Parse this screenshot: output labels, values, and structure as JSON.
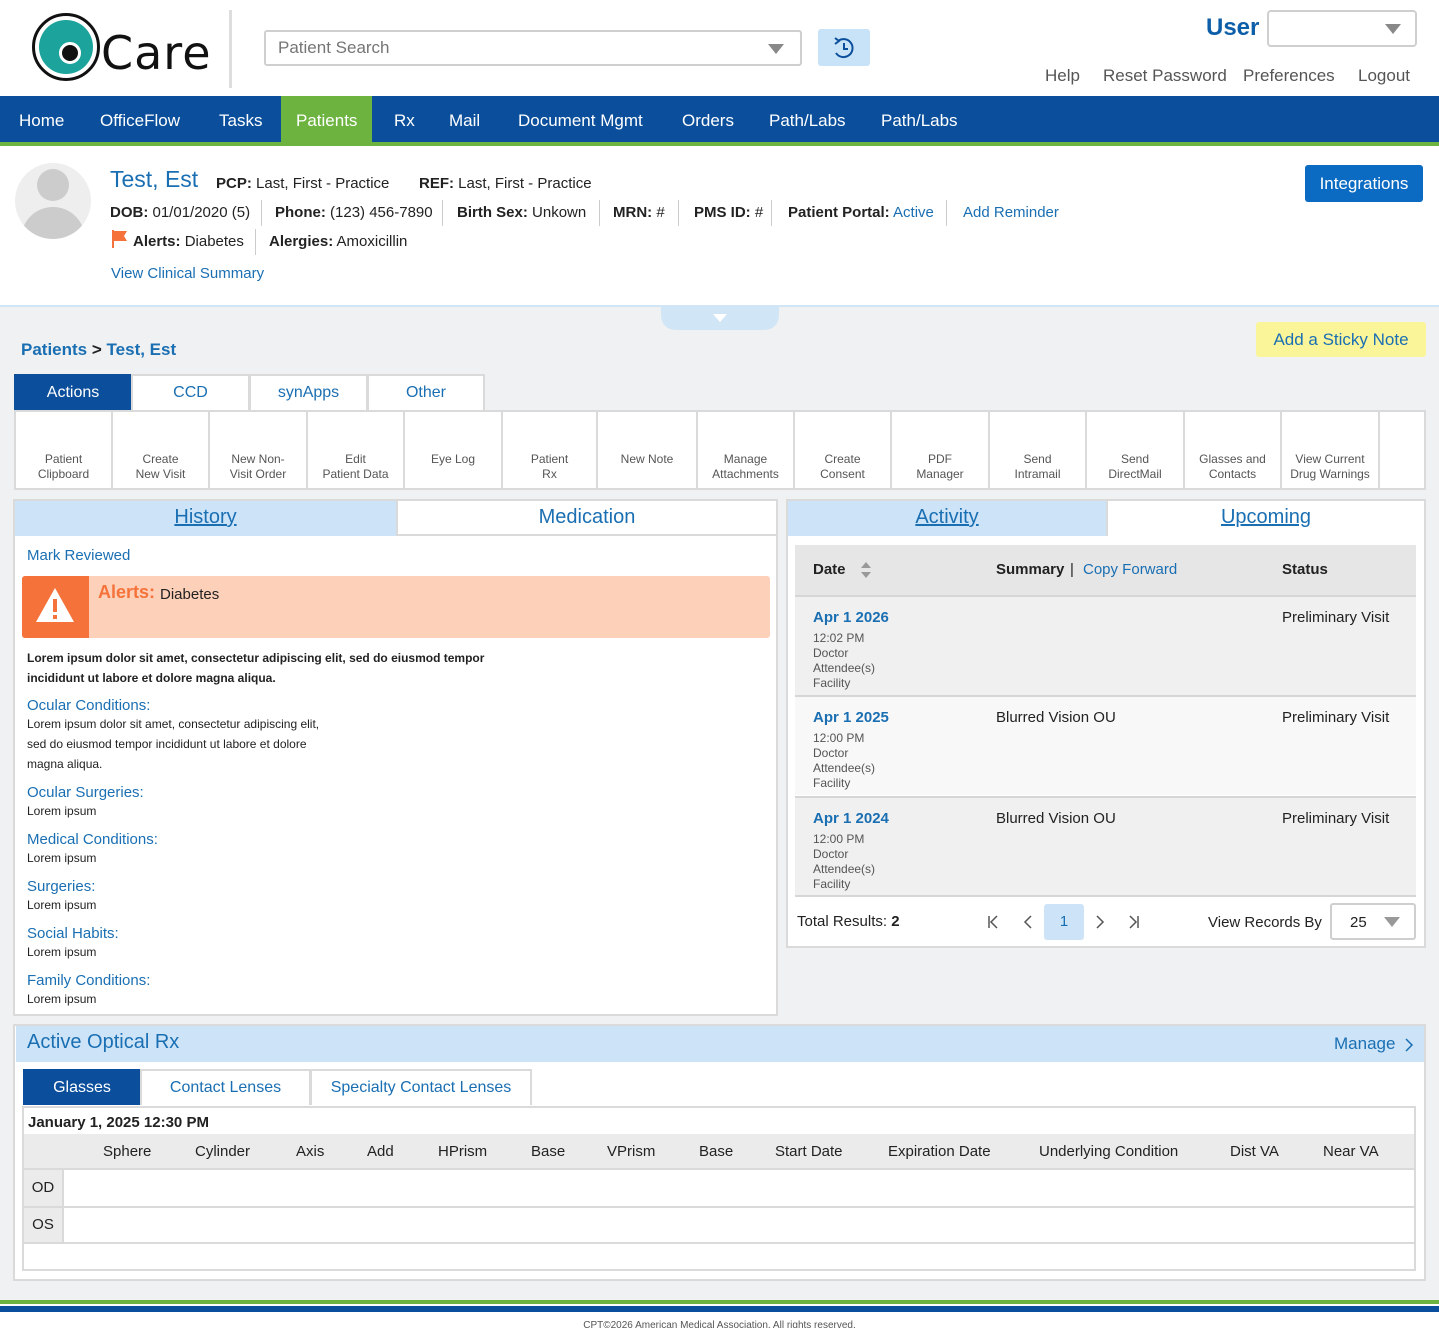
{
  "app": {
    "logo_text": "Care",
    "search_placeholder": "Patient Search",
    "user_label": "User",
    "top_links": [
      "Help",
      "Reset Password",
      "Preferences",
      "Logout"
    ]
  },
  "nav": {
    "items": [
      "Home",
      "OfficeFlow",
      "Tasks",
      "Patients",
      "Rx",
      "Mail",
      "Document Mgmt",
      "Orders",
      "Path/Labs",
      "Path/Labs"
    ],
    "active": "Patients"
  },
  "patient": {
    "name": "Test, Est",
    "pcp_label": "PCP:",
    "pcp_value": "Last, First - Practice",
    "ref_label": "REF:",
    "ref_value": "Last, First - Practice",
    "dob_label": "DOB:",
    "dob_value": "01/01/2020 (5)",
    "phone_label": "Phone:",
    "phone_value": "(123) 456-7890",
    "sex_label": "Birth Sex:",
    "sex_value": "Unkown",
    "mrn_label": "MRN:",
    "mrn_value": "#",
    "pms_label": "PMS ID:",
    "pms_value": "#",
    "portal_label": "Patient Portal:",
    "portal_value": "Active",
    "add_reminder": "Add Reminder",
    "alerts_label": "Alerts:",
    "alerts_value": "Diabetes",
    "allergies_label": "Alergies:",
    "allergies_value": "Amoxicillin",
    "clinical_summary": "View Clinical Summary",
    "integrations": "Integrations"
  },
  "breadcrumb": {
    "root": "Patients",
    "sep": ">",
    "current": "Test, Est"
  },
  "sticky_note": "Add a Sticky Note",
  "action_tabs": [
    "Actions",
    "CCD",
    "synApps",
    "Other"
  ],
  "tools": [
    [
      "Patient",
      "Clipboard"
    ],
    [
      "Create",
      "New Visit"
    ],
    [
      "New Non-",
      "Visit Order"
    ],
    [
      "Edit",
      "Patient Data"
    ],
    [
      "Eye Log",
      ""
    ],
    [
      "Patient",
      "Rx"
    ],
    [
      "New Note",
      ""
    ],
    [
      "Manage",
      "Attachments"
    ],
    [
      "Create",
      "Consent"
    ],
    [
      "PDF",
      "Manager"
    ],
    [
      "Send",
      "Intramail"
    ],
    [
      "Send",
      "DirectMail"
    ],
    [
      "Glasses and",
      "Contacts"
    ],
    [
      "View Current",
      "Drug Warnings"
    ]
  ],
  "history": {
    "tabs": [
      "History",
      "Medication"
    ],
    "mark_reviewed": "Mark Reviewed",
    "alert_label": "Alerts:",
    "alert_value": "Diabetes",
    "intro_line1": "Lorem ipsum dolor sit amet, consectetur adipiscing elit, sed do eiusmod tempor",
    "intro_line2": "incididunt ut labore et dolore magna aliqua.",
    "sections": [
      {
        "title": "Ocular Conditions:",
        "lines": [
          "Lorem ipsum dolor sit amet, consectetur adipiscing elit,",
          "sed do eiusmod tempor incididunt ut labore et dolore",
          "magna aliqua."
        ]
      },
      {
        "title": "Ocular Surgeries:",
        "lines": [
          "Lorem ipsum"
        ]
      },
      {
        "title": "Medical Conditions:",
        "lines": [
          "Lorem ipsum"
        ]
      },
      {
        "title": "Surgeries:",
        "lines": [
          "Lorem ipsum"
        ]
      },
      {
        "title": "Social Habits:",
        "lines": [
          "Lorem ipsum"
        ]
      },
      {
        "title": "Family Conditions:",
        "lines": [
          "Lorem ipsum"
        ]
      }
    ]
  },
  "activity": {
    "tabs": [
      "Activity",
      "Upcoming"
    ],
    "col_date": "Date",
    "col_summary": "Summary",
    "copy_forward": "Copy Forward",
    "col_status": "Status",
    "rows": [
      {
        "date": "Apr 1 2026",
        "time": "12:02 PM",
        "doctor": "Doctor",
        "attendees": "Attendee(s)",
        "facility": "Facility",
        "summary": "",
        "status": "Preliminary Visit"
      },
      {
        "date": "Apr 1 2025",
        "time": "12:00 PM",
        "doctor": "Doctor",
        "attendees": "Attendee(s)",
        "facility": "Facility",
        "summary": "Blurred Vision OU",
        "status": "Preliminary Visit"
      },
      {
        "date": "Apr 1 2024",
        "time": "12:00 PM",
        "doctor": "Doctor",
        "attendees": "Attendee(s)",
        "facility": "Facility",
        "summary": "Blurred Vision OU",
        "status": "Preliminary Visit"
      }
    ],
    "total_label": "Total Results:",
    "total_value": "2",
    "page": "1",
    "view_records_label": "View Records By",
    "view_records_value": "25"
  },
  "optical": {
    "title": "Active Optical Rx",
    "manage": "Manage",
    "tabs": [
      "Glasses",
      "Contact Lenses",
      "Specialty Contact Lenses"
    ],
    "date": "January 1, 2025 12:30 PM",
    "columns": [
      "Sphere",
      "Cylinder",
      "Axis",
      "Add",
      "HPrism",
      "Base",
      "VPrism",
      "Base",
      "Start Date",
      "Expiration Date",
      "Underlying Condition",
      "Dist VA",
      "Near VA"
    ],
    "rows": [
      "OD",
      "OS"
    ]
  },
  "footer": "CPT©2026 American Medical Association. All rights reserved.",
  "colors": {
    "brand_blue": "#0b4f9c",
    "accent_green": "#6db33f",
    "link_blue": "#1a6fb3",
    "alert_orange": "#f5733a"
  }
}
